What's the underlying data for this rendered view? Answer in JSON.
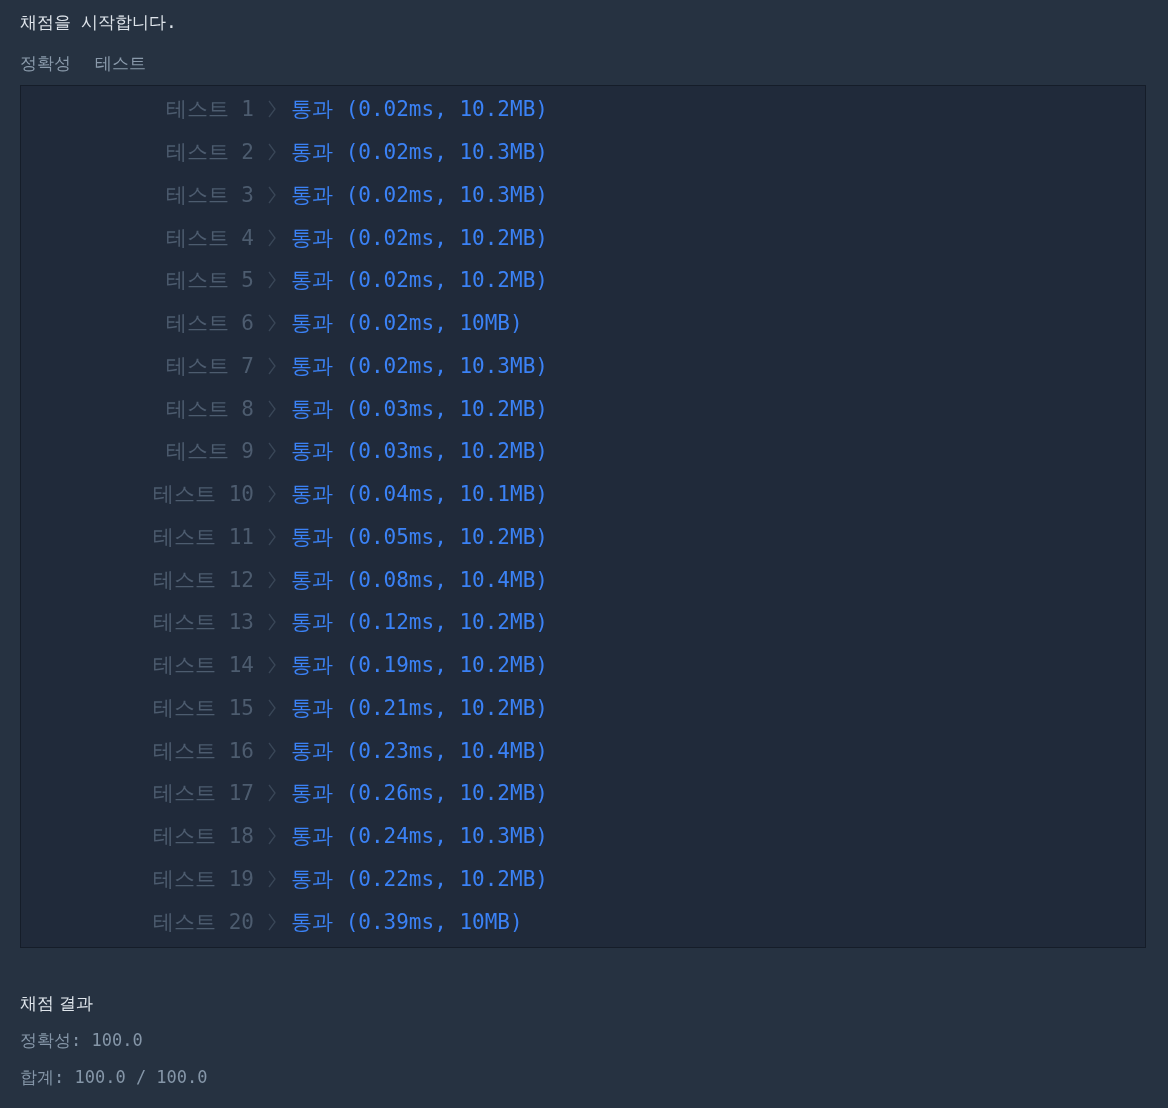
{
  "intro": "채점을 시작합니다.",
  "section_tabs": [
    "정확성",
    "테스트"
  ],
  "tests": [
    {
      "label": "테스트 1",
      "passed": true,
      "result": "통과 (0.02ms, 10.2MB)"
    },
    {
      "label": "테스트 2",
      "passed": true,
      "result": "통과 (0.02ms, 10.3MB)"
    },
    {
      "label": "테스트 3",
      "passed": true,
      "result": "통과 (0.02ms, 10.3MB)"
    },
    {
      "label": "테스트 4",
      "passed": true,
      "result": "통과 (0.02ms, 10.2MB)"
    },
    {
      "label": "테스트 5",
      "passed": true,
      "result": "통과 (0.02ms, 10.2MB)"
    },
    {
      "label": "테스트 6",
      "passed": true,
      "result": "통과 (0.02ms, 10MB)"
    },
    {
      "label": "테스트 7",
      "passed": true,
      "result": "통과 (0.02ms, 10.3MB)"
    },
    {
      "label": "테스트 8",
      "passed": true,
      "result": "통과 (0.03ms, 10.2MB)"
    },
    {
      "label": "테스트 9",
      "passed": true,
      "result": "통과 (0.03ms, 10.2MB)"
    },
    {
      "label": "테스트 10",
      "passed": true,
      "result": "통과 (0.04ms, 10.1MB)"
    },
    {
      "label": "테스트 11",
      "passed": true,
      "result": "통과 (0.05ms, 10.2MB)"
    },
    {
      "label": "테스트 12",
      "passed": true,
      "result": "통과 (0.08ms, 10.4MB)"
    },
    {
      "label": "테스트 13",
      "passed": true,
      "result": "통과 (0.12ms, 10.2MB)"
    },
    {
      "label": "테스트 14",
      "passed": true,
      "result": "통과 (0.19ms, 10.2MB)"
    },
    {
      "label": "테스트 15",
      "passed": true,
      "result": "통과 (0.21ms, 10.2MB)"
    },
    {
      "label": "테스트 16",
      "passed": true,
      "result": "통과 (0.23ms, 10.4MB)"
    },
    {
      "label": "테스트 17",
      "passed": true,
      "result": "통과 (0.26ms, 10.2MB)"
    },
    {
      "label": "테스트 18",
      "passed": true,
      "result": "통과 (0.24ms, 10.3MB)"
    },
    {
      "label": "테스트 19",
      "passed": true,
      "result": "통과 (0.22ms, 10.2MB)"
    },
    {
      "label": "테스트 20",
      "passed": true,
      "result": "통과 (0.39ms, 10MB)"
    }
  ],
  "summary": {
    "title": "채점 결과",
    "lines": [
      "정확성: 100.0",
      "합계: 100.0 / 100.0"
    ]
  }
}
